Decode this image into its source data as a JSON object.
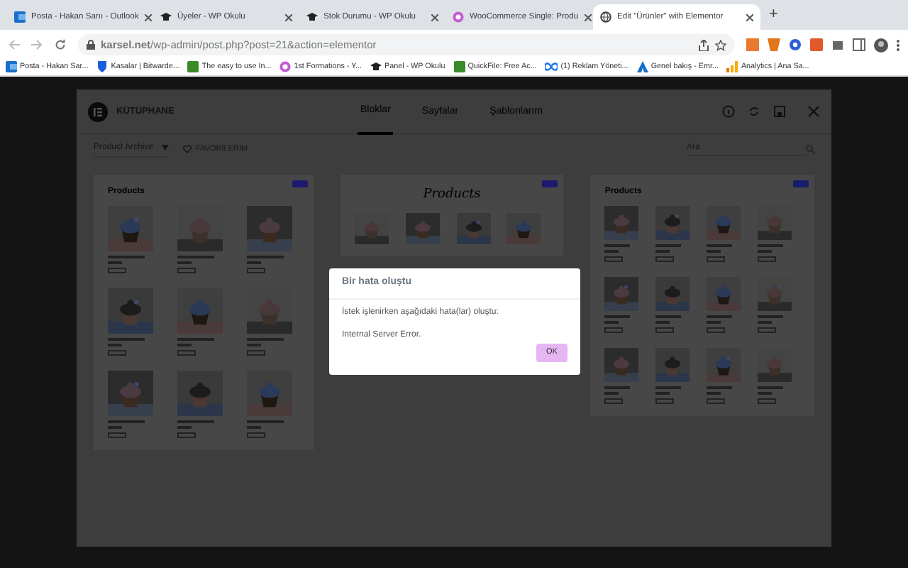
{
  "browser": {
    "tabs": [
      {
        "title": "Posta - Hakan Sarıı - Outlook",
        "selected": false
      },
      {
        "title": "Üyeler - WP Okulu",
        "selected": false
      },
      {
        "title": "Stok Durumu - WP Okulu",
        "selected": false
      },
      {
        "title": "WooCommerce Single: Produ",
        "selected": false
      },
      {
        "title": "Edit \"Ürünler\" with Elementor",
        "selected": true
      }
    ],
    "new_tab": "+",
    "address": "**karsel.net**/wp-admin/post.php?post=21&action=elementor",
    "bookmarks": [
      "Posta - Hakan Sar...",
      "Kasalar | Bitwarde...",
      "The easy to use In...",
      "1st Formations - Y...",
      "Panel - WP Okulu",
      "QuickFile: Free Ac...",
      "(1) Reklam Yöneti...",
      "Genel bakış - Emr...",
      "Analytics | Ana Sa..."
    ]
  },
  "library": {
    "title": "KÜTÜPHANE",
    "tabs": [
      {
        "label": "Bloklar",
        "selected": true
      },
      {
        "label": "Sayfalar",
        "selected": false
      },
      {
        "label": "Şablonlarım",
        "selected": false
      }
    ],
    "filter": {
      "value": "Product Archive"
    },
    "favorites": "FAVORİLERİM",
    "search": {
      "placeholder": "Ara"
    },
    "cards": [
      {
        "kind": "small",
        "heading": "Products"
      },
      {
        "kind": "script",
        "heading": "Products"
      },
      {
        "kind": "large",
        "heading": "Products"
      }
    ]
  },
  "dialog": {
    "title": "Bir hata oluştu",
    "message": "İstek işlenirken aşağıdaki hata(lar) oluştu:",
    "error": "Internal Server Error.",
    "button": "OK"
  }
}
